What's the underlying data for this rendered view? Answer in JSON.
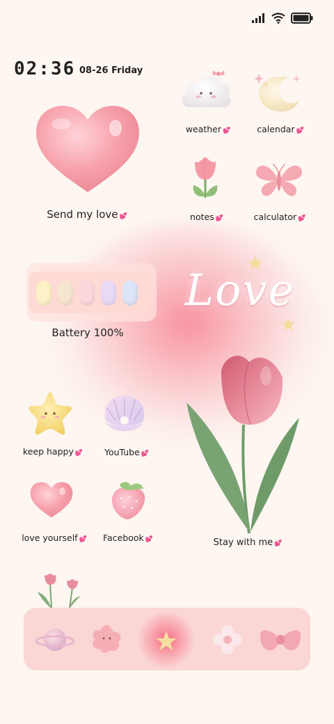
{
  "status_bar": {
    "icons": [
      "signal-icon",
      "wifi-icon",
      "battery-icon"
    ]
  },
  "clock": {
    "time": "02:36",
    "date": "08-26 Friday"
  },
  "widgets": {
    "heart_widget": {
      "label": "Send my love",
      "heart": "💕"
    },
    "battery": {
      "label": "Battery  100%",
      "level": 1.0,
      "cells": [
        "#fdf1c7",
        "#f7e6cf",
        "#fbd7dc",
        "#e8daf6",
        "#dce4f8"
      ]
    },
    "love_text": "Love",
    "tulip_widget": {
      "label": "Stay with me",
      "heart": "💕"
    }
  },
  "apps": [
    {
      "id": "weather",
      "label": "weather",
      "heart": "💕"
    },
    {
      "id": "calendar",
      "label": "calendar",
      "heart": "💕"
    },
    {
      "id": "notes",
      "label": "notes",
      "heart": "💕"
    },
    {
      "id": "calculator",
      "label": "calculator",
      "heart": "💕"
    },
    {
      "id": "keep-happy",
      "label": "keep happy",
      "heart": "💕"
    },
    {
      "id": "youtube",
      "label": "YouTube",
      "heart": "💕"
    },
    {
      "id": "love-yourself",
      "label": "love yourself",
      "heart": "💕"
    },
    {
      "id": "facebook",
      "label": "Facebook",
      "heart": "💕"
    }
  ],
  "dock": [
    "planet-icon",
    "flower-blob-icon",
    "star-icon",
    "flower-icon",
    "bow-icon"
  ],
  "colors": {
    "background": "#fdf6f1",
    "accent_pink": "#f7a3ad",
    "heart_glyph": "#e94fa6",
    "dock": "#fad6d5"
  }
}
